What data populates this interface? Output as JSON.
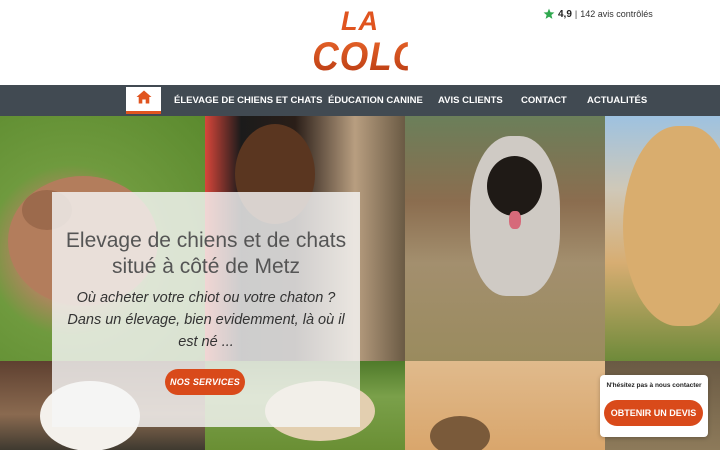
{
  "brand": {
    "logo_line1": "LA",
    "logo_line2": "COLO",
    "accent_color": "#e0541f",
    "nav_color": "#414a52"
  },
  "rating": {
    "score": "4,9",
    "separator": "|",
    "text": "142 avis contrôlés",
    "icon": "star-icon"
  },
  "nav": {
    "home_icon": "home-icon",
    "items": [
      {
        "label": "ÉLEVAGE DE CHIENS ET CHATS"
      },
      {
        "label": "ÉDUCATION CANINE"
      },
      {
        "label": "AVIS CLIENTS"
      },
      {
        "label": "CONTACT"
      },
      {
        "label": "ACTUALITÉS"
      }
    ]
  },
  "hero": {
    "title": "Elevage de chiens et de chats situé à côté de Metz",
    "subtitle": "Où acheter votre chiot ou votre chaton ? Dans un élevage, bien evidemment, là où il est né ...",
    "button_label": "NOS SERVICES"
  },
  "contact_widget": {
    "text": "N'hésitez pas à nous contacter",
    "button_label": "OBTENIR UN DEVIS"
  }
}
